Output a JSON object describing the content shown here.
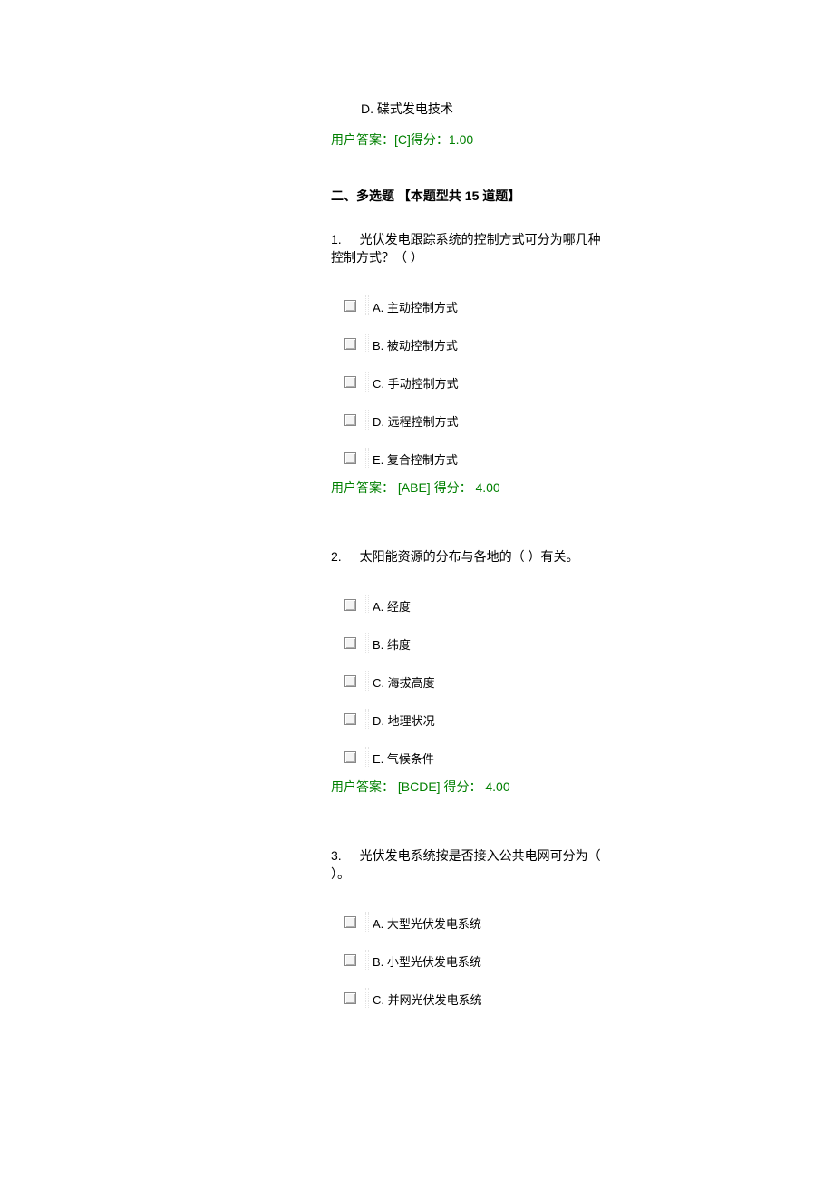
{
  "prev_option_d": "D. 碟式发电技术",
  "prev_answer": {
    "prefix": "用户答案：",
    "ans": "[C]",
    "score_label": "得分：",
    "score": "1.00"
  },
  "section2_title": "二、多选题 【本题型共 15 道题】",
  "questions": [
    {
      "num": "1.",
      "text": "光伏发电跟踪系统的控制方式可分为哪几种控制方式？（ ）",
      "options": [
        "A. 主动控制方式",
        "B. 被动控制方式",
        "C. 手动控制方式",
        "D. 远程控制方式",
        "E. 复合控制方式"
      ],
      "answer": {
        "prefix": "用户答案：",
        "ans": "[ABE]",
        "score_label": "得分：",
        "score": "4.00"
      }
    },
    {
      "num": "2.",
      "text": "太阳能资源的分布与各地的（ ）有关。",
      "options": [
        "A. 经度",
        "B. 纬度",
        "C. 海拔高度",
        "D. 地理状况",
        "E. 气候条件"
      ],
      "answer": {
        "prefix": "用户答案：",
        "ans": "[BCDE]",
        "score_label": "得分：",
        "score": "4.00"
      }
    },
    {
      "num": "3.",
      "text": "光伏发电系统按是否接入公共电网可分为（ ）。",
      "options": [
        "A. 大型光伏发电系统",
        "B. 小型光伏发电系统",
        "C. 并网光伏发电系统"
      ],
      "answer": null
    }
  ]
}
